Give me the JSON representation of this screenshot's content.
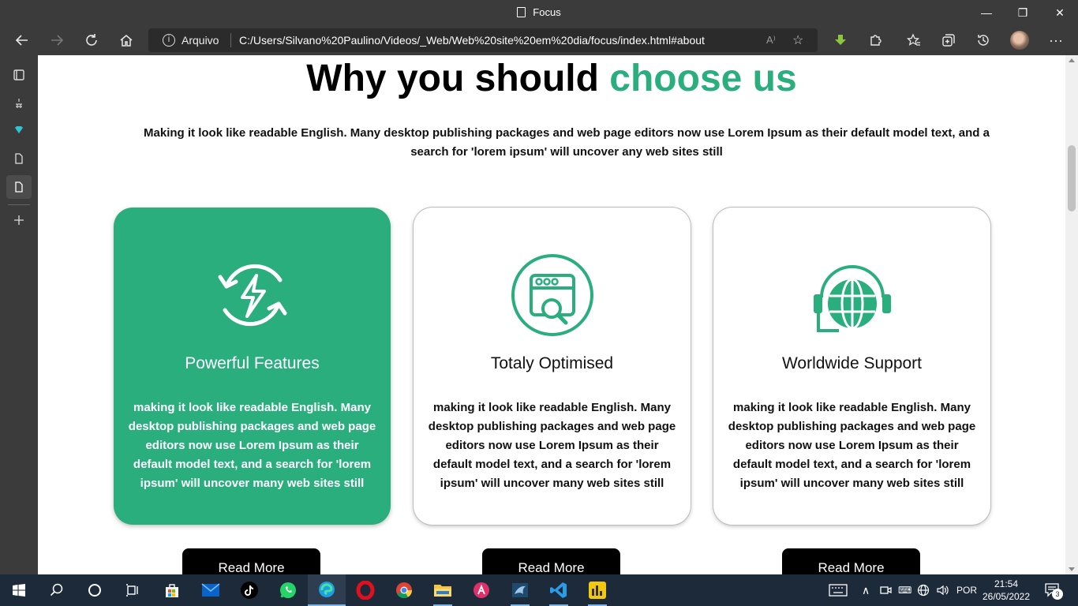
{
  "window": {
    "title": "Focus",
    "minimize_glyph": "—",
    "maximize_glyph": "❐",
    "close_glyph": "✕"
  },
  "toolbar": {
    "address_scheme": "Arquivo",
    "address_url": "C:/Users/Silvano%20Paulino/Videos/_Web/Web%20site%20em%20dia/focus/index.html#about",
    "read_aloud_glyph": "A⁾",
    "more_glyph": "···"
  },
  "page": {
    "heading_main": "Why you should ",
    "heading_accent": "choose us",
    "intro": "Making it look like readable English. Many desktop publishing packages and web page editors now use Lorem Ipsum as their default model text, and a search for 'lorem ipsum' will uncover any web sites still",
    "cards": [
      {
        "title": "Powerful Features",
        "text": "making it look like readable English. Many desktop publishing packages and web page editors now use Lorem Ipsum as their default model text, and a search for 'lorem ipsum' will uncover many web sites still",
        "button": "Read More",
        "icon": "lightning-refresh-icon"
      },
      {
        "title": "Totaly Optimised",
        "text": "making it look like readable English. Many desktop publishing packages and web page editors now use Lorem Ipsum as their default model text, and a search for 'lorem ipsum' will uncover many web sites still",
        "button": "Read More",
        "icon": "browser-search-icon"
      },
      {
        "title": "Worldwide Support",
        "text": "making it look like readable English. Many desktop publishing packages and web page editors now use Lorem Ipsum as their default model text, and a search for 'lorem ipsum' will uncover many web sites still",
        "button": "Read More",
        "icon": "globe-headset-icon"
      }
    ],
    "accent_color": "#2aae7e"
  },
  "taskbar": {
    "language": "POR",
    "time": "21:54",
    "date": "26/05/2022",
    "notification_count": "3"
  }
}
